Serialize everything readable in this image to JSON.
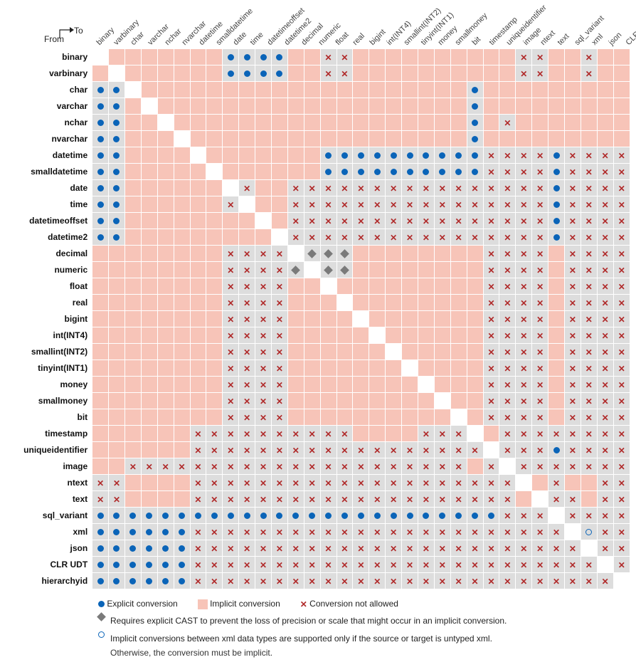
{
  "corner": {
    "from": "From",
    "to": "To"
  },
  "types": [
    "binary",
    "varbinary",
    "char",
    "varchar",
    "nchar",
    "nvarchar",
    "datetime",
    "smalldatetime",
    "date",
    "time",
    "datetimeoffset",
    "datetime2",
    "decimal",
    "numeric",
    "float",
    "real",
    "bigint",
    "int(INT4)",
    "smallint(INT2)",
    "tinyint(INT1)",
    "money",
    "smallmoney",
    "bit",
    "timestamp",
    "uniqueidentifier",
    "image",
    "ntext",
    "text",
    "sql_variant",
    "xml",
    "json",
    "CLR UDT",
    "hierarchyid"
  ],
  "legend": {
    "explicit": "Explicit conversion",
    "implicit": "Implicit conversion",
    "notallowed": "Conversion not allowed",
    "cast": "Requires explicit CAST to prevent the loss of precision or scale that might occur in an implicit conversion.",
    "xml": "Implicit conversions between xml data types are supported only if the source or target is untyped xml.",
    "xml2": "Otherwise, the conversion must be implicit."
  },
  "matrix": {
    "comment": "codes: s=self(white), i=implicit(pink), e=explicit(dot on gray), x=not-allowed(cross on gray), d=diamond(cast on gray), r=ring(xml note on gray), w=blank white, g=blank gray",
    "rows": [
      "s i i i i i i i e e e e i i x x i i i i i i i i i i x x i i x i i",
      "i s i i i i i i e e e e i i x x i i i i i i i i i i x x i i x i i",
      "e e s i i i i i i i i i i i i i i i i i i i i e i i i i i i i i i",
      "e e i s i i i i i i i i i i i i i i i i i i i e i i i i i i i i i",
      "e e i i s i i i i i i i i i i i i i i i i i i e i x i i i i i i i",
      "e e i i i s i i i i i i i i i i i i i i i i i e i i i i i i i i i",
      "e e i i i i s i i i i i i i e e e e e e e e e e x x x x e x x x x",
      "e e i i i i i s i i i i i i e e e e e e e e e e x x x x e x x x x",
      "e e i i i i i i s x i i x x x x x x x x x x x x x x x x e x x x x",
      "e e i i i i i i x s i i x x x x x x x x x x x x x x x x e x x x x",
      "e e i i i i i i i i s i x x x x x x x x x x x x x x x x e x x x x",
      "e e i i i i i i i i i s x x x x x x x x x x x x x x x x e x x x x",
      "i i i i i i i i x x x x s d d d i i i i i i i i x x x x i x x x x",
      "i i i i i i i i x x x x d s d d i i i i i i i i x x x x i x x x x",
      "i i i i i i i i x x x x i i s i i i i i i i i i x x x x i x x x x",
      "i i i i i i i i x x x x i i i s i i i i i i i i x x x x i x x x x",
      "i i i i i i i i x x x x i i i i s i i i i i i i x x x x i x x x x",
      "i i i i i i i i x x x x i i i i i s i i i i i i x x x x i x x x x",
      "i i i i i i i i x x x x i i i i i i s i i i i i x x x x i x x x x",
      "i i i i i i i i x x x x i i i i i i i s i i i i x x x x i x x x x",
      "i i i i i i i i x x x x i i i i i i i i s i i i x x x x i x x x x",
      "i i i i i i i i x x x x i i i i i i i i i s i i x x x x i x x x x",
      "i i i i i i i i x x x x i i i i i i i i i i s i x x x x i x x x x",
      "i i i i i i x x x x x x x x x x i i i i x x x w i x x x x x x x x",
      "i i i i i i x x x x x x x x x x x x x x x x x x s x x x e x x x x",
      "i i x x x x x x x x x x x x x x x x x x x x x i x s x x x x x x x",
      "x x i i i i x x x x x x x x x x x x x x x x x x x x s i x i i x x",
      "x x i i i i x x x x x x x x x x x x x x x x x x x x i s x x i x x",
      "e e e e e e e e e e e e e e e e e e e e e e e e e x x x s x x x x",
      "e e e e e e x x x x x x x x x x x x x x x x x x x x x x x s r x x",
      "e e e e e e x x x x x x x x x x x x x x x x x x x x x x x x s x x",
      "e e e e e e x x x x x x x x x x x x x x x x x x x x x x x x x s x",
      "e e e e e e x x x x x x x x x x x x x x x x x x x x x x x x x x s"
    ]
  }
}
